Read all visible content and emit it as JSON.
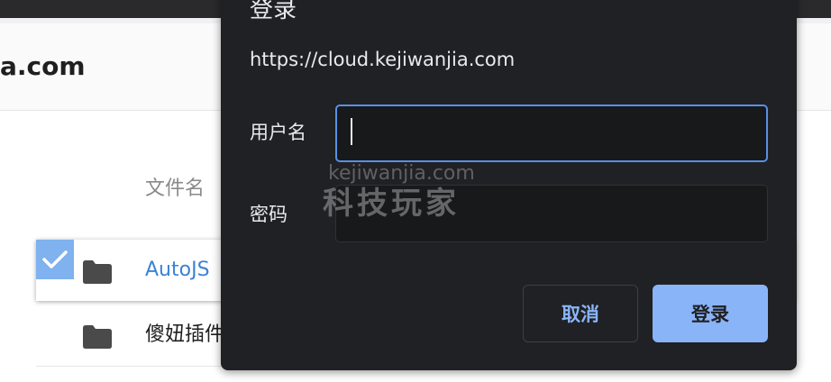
{
  "background": {
    "site_name": "a.com",
    "column_header": "文件名",
    "files": [
      {
        "name": "AutoJS",
        "selected": true,
        "icon": "folder-icon"
      },
      {
        "name": "傻妞插件",
        "selected": false,
        "icon": "folder-icon"
      }
    ]
  },
  "dialog": {
    "title": "登录",
    "url": "https://cloud.kejiwanjia.com",
    "username_label": "用户名",
    "username_value": "",
    "password_label": "密码",
    "password_value": "",
    "cancel_label": "取消",
    "login_label": "登录"
  },
  "watermark": {
    "url": "kejiwanjia.com",
    "text": "科技玩家"
  },
  "colors": {
    "dialog_bg": "#202124",
    "accent": "#8ab4f8",
    "focus_border": "#5a8fe6",
    "link_blue": "#3b83d4",
    "checkbox_blue": "#7fb2ee"
  }
}
